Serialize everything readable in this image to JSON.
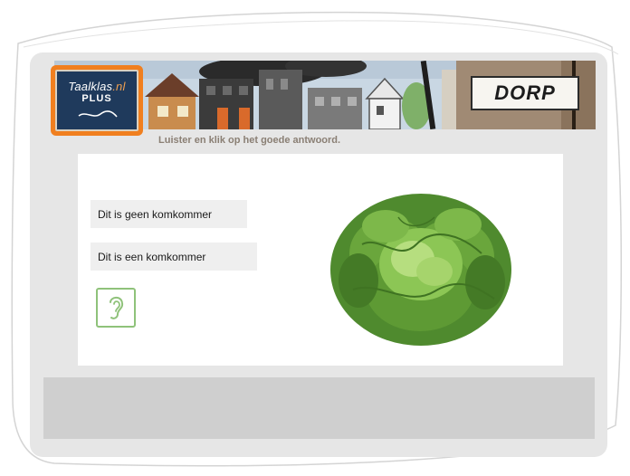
{
  "header": {
    "logo": {
      "line1_main": "Taalklas",
      "line1_accent": ".nl",
      "line2": "PLUS"
    },
    "sign": "DORP"
  },
  "exercise": {
    "instruction": "Luister en klik op het goede antwoord.",
    "answers": [
      {
        "label": "Dit is geen komkommer"
      },
      {
        "label": "Dit is een komkommer"
      }
    ],
    "listen_icon": "ear-icon",
    "image_subject": "lettuce"
  },
  "colors": {
    "logo_orange": "#f07f1f",
    "logo_board": "#1f3a5c",
    "panel_grey": "#e6e6e6",
    "bottom_bar": "#cfcfcf",
    "listen_green": "#8fc27a",
    "instruction_text": "#8a7f74"
  }
}
